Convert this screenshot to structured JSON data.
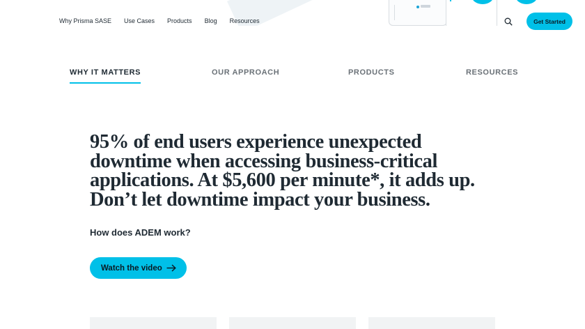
{
  "topnav": {
    "items": [
      "Why Prisma SASE",
      "Use Cases",
      "Products",
      "Blog",
      "Resources"
    ],
    "cta_label": "Get Started"
  },
  "tabs": [
    {
      "label": "WHY IT MATTERS",
      "active": true
    },
    {
      "label": "OUR APPROACH",
      "active": false
    },
    {
      "label": "PRODUCTS",
      "active": false
    },
    {
      "label": "RESOURCES",
      "active": false
    }
  ],
  "main": {
    "headline": "95% of end users experience unexpected downtime when accessing business-critical applications. At $5,600 per minute*, it adds up. Don’t let downtime impact your business.",
    "question": "How does ADEM work?",
    "video_button_label": "Watch the video"
  },
  "colors": {
    "accent": "#00c0e8",
    "text": "#1f2a33"
  }
}
